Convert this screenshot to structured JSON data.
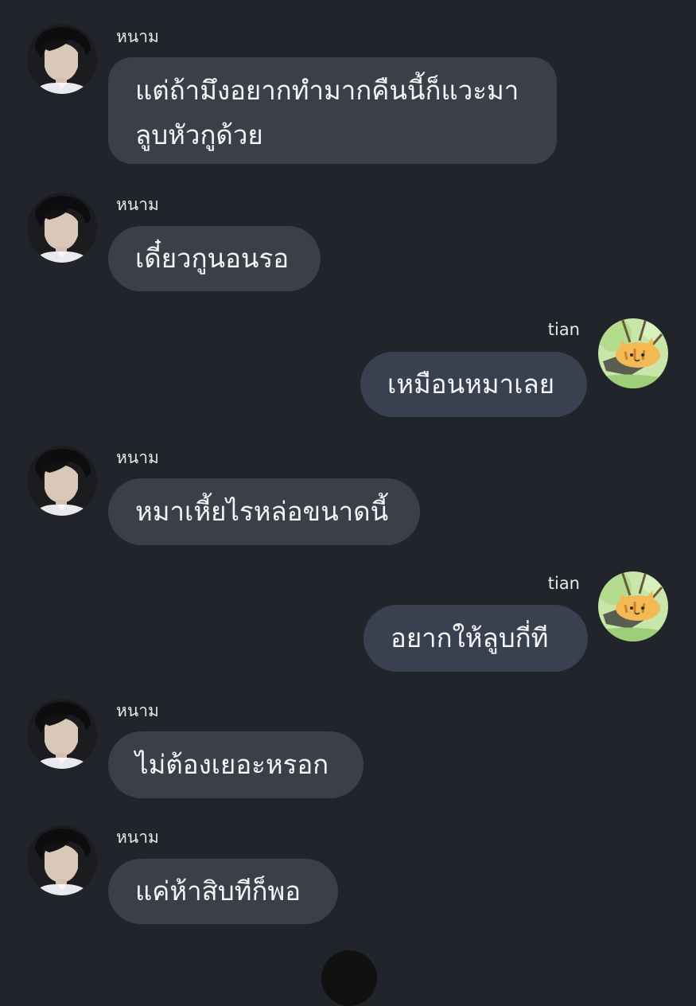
{
  "contacts": {
    "other": {
      "name": "หนาม"
    },
    "self": {
      "name": "tian"
    }
  },
  "messages": [
    {
      "sender": "หนาม",
      "text": "แต่ถ้ามึงอยากทำมากคืนนี้ก็แวะมา\nลูบหัวกูด้วย"
    },
    {
      "sender": "หนาม",
      "text": "เดี๋ยวกูนอนรอ"
    },
    {
      "sender": "tian",
      "text": "เหมือนหมาเลย"
    },
    {
      "sender": "หนาม",
      "text": "หมาเหี้ยไรหล่อขนาดนี้"
    },
    {
      "sender": "tian",
      "text": "อยากให้ลูบกี่ที"
    },
    {
      "sender": "หนาม",
      "text": "ไม่ต้องเยอะหรอก"
    },
    {
      "sender": "หนาม",
      "text": "แค่ห้าสิบทีก็พอ"
    }
  ],
  "colors": {
    "background": "#22242c",
    "incoming_bubble": "#3c3f48",
    "outgoing_bubble": "#39404f",
    "text": "#f3f4f6"
  }
}
